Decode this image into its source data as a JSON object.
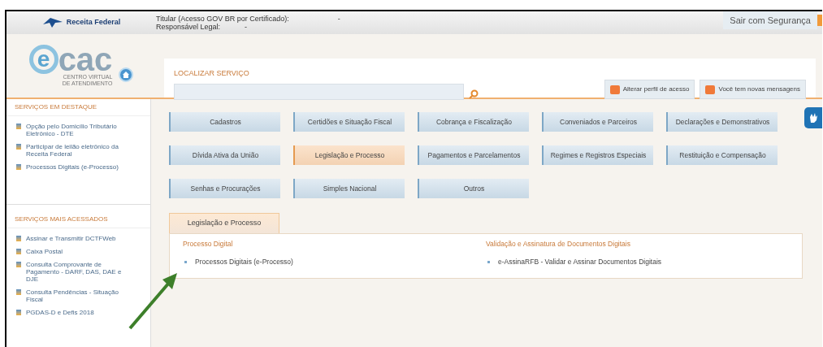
{
  "header": {
    "brand": "Receita Federal",
    "titular_label": "Titular (Acesso GOV BR por Certificado):",
    "titular_value": "-",
    "responsavel_label": "Responsável Legal:",
    "responsavel_value": "-",
    "logout": "Sair com Segurança"
  },
  "logo": {
    "letter": "e",
    "word": "cac",
    "line_1": "CENTRO VIRTUAL",
    "line_2": "DE ATENDIMENTO"
  },
  "search": {
    "label": "LOCALIZAR SERVIÇO"
  },
  "actions": [
    "Alterar perfil de acesso",
    "Você tem novas mensagens"
  ],
  "sidebar": [
    {
      "title": "SERVIÇOS EM DESTAQUE",
      "items": [
        "Opção pelo Domicílio Tributário Eletrônico - DTE",
        "Participar de leilão eletrônico da Receita Federal",
        "Processos Digitais (e-Processo)"
      ]
    },
    {
      "title": "SERVIÇOS MAIS ACESSADOS",
      "items": [
        "Assinar e Transmitir DCTFWeb",
        "Caixa Postal",
        "Consulta Comprovante de Pagamento - DARF, DAS, DAE e DJE",
        "Consulta Pendências - Situação Fiscal",
        "PGDAS-D e Defis 2018"
      ]
    }
  ],
  "categories": [
    {
      "label": "Cadastros",
      "selected": false
    },
    {
      "label": "Certidões e Situação Fiscal",
      "selected": false
    },
    {
      "label": "Cobrança e Fiscalização",
      "selected": false
    },
    {
      "label": "Conveniados e Parceiros",
      "selected": false
    },
    {
      "label": "Declarações e Demonstrativos",
      "selected": false
    },
    {
      "label": "Dívida Ativa da União",
      "selected": false
    },
    {
      "label": "Legislação e Processo",
      "selected": true
    },
    {
      "label": "Pagamentos e Parcelamentos",
      "selected": false
    },
    {
      "label": "Regimes e Registros Especiais",
      "selected": false
    },
    {
      "label": "Restituição e Compensação",
      "selected": false
    },
    {
      "label": "Senhas e Procurações",
      "selected": false
    },
    {
      "label": "Simples Nacional",
      "selected": false
    },
    {
      "label": "Outros",
      "selected": false
    }
  ],
  "panel": {
    "tab": "Legislação e Processo",
    "groups": [
      {
        "heading": "Processo Digital",
        "links": [
          "Processos Digitais (e-Processo)"
        ]
      },
      {
        "heading": "Validação e Assinatura de Documentos Digitais",
        "links": [
          "e-AssinaRFB - Validar e Assinar Documentos Digitais"
        ]
      }
    ]
  }
}
